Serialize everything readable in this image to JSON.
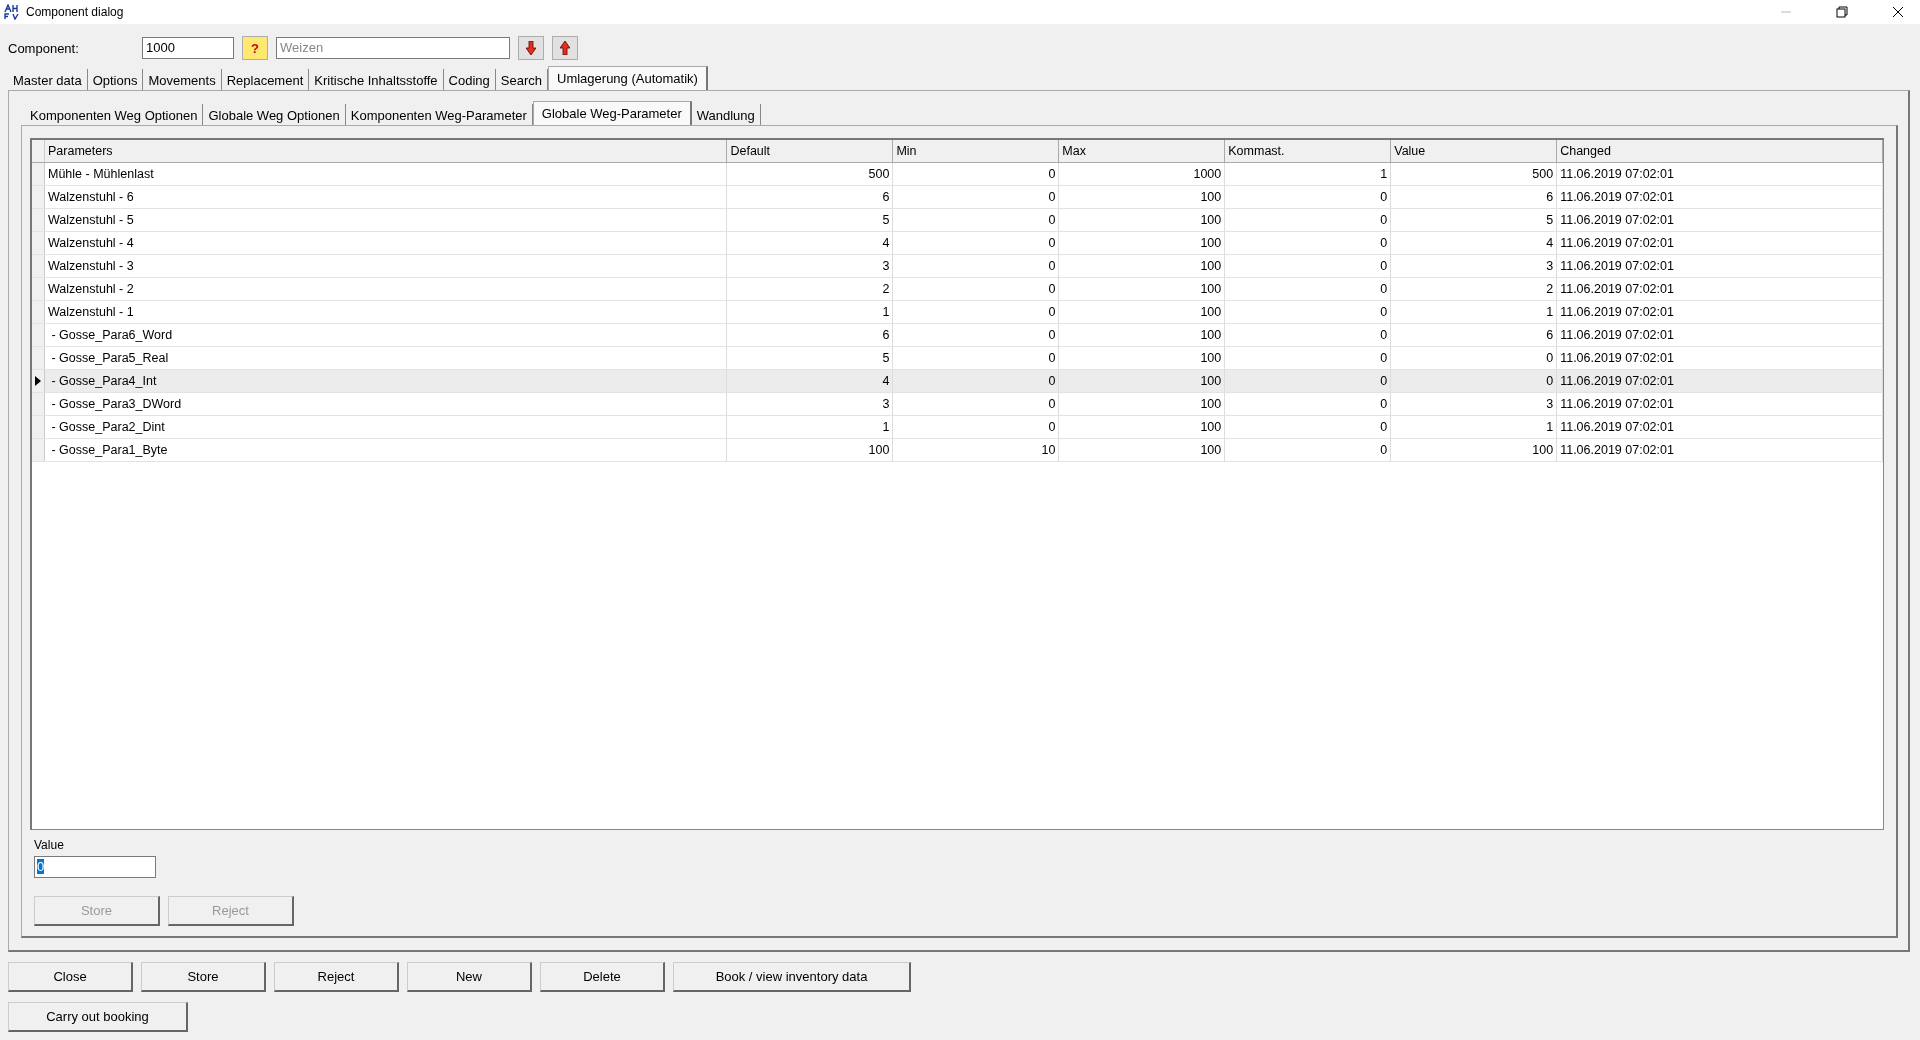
{
  "window": {
    "title": "Component dialog"
  },
  "component": {
    "label": "Component:",
    "number": "1000",
    "help": "?",
    "name": {
      "value": "Weizen",
      "disabled": true
    }
  },
  "tabs": [
    {
      "label": "Master data",
      "selected": false
    },
    {
      "label": "Options",
      "selected": false
    },
    {
      "label": "Movements",
      "selected": false
    },
    {
      "label": "Replacement",
      "selected": false
    },
    {
      "label": "Kritische Inhaltsstoffe",
      "selected": false
    },
    {
      "label": "Coding",
      "selected": false
    },
    {
      "label": "Search",
      "selected": false
    },
    {
      "label": "Umlagerung (Automatik)",
      "selected": true
    }
  ],
  "subtabs": [
    {
      "label": "Komponenten Weg Optionen",
      "selected": false
    },
    {
      "label": "Globale Weg Optionen",
      "selected": false
    },
    {
      "label": "Komponenten Weg-Parameter",
      "selected": false
    },
    {
      "label": "Globale Weg-Parameter",
      "selected": true
    },
    {
      "label": "Wandlung",
      "selected": false
    }
  ],
  "table": {
    "columns": [
      "Parameters",
      "Default",
      "Min",
      "Max",
      "Kommast.",
      "Value",
      "Changed"
    ],
    "rows": [
      {
        "selected": false,
        "cells": [
          "Mühle - Mühlenlast",
          "500",
          "0",
          "1000",
          "1",
          "500",
          "11.06.2019 07:02:01"
        ]
      },
      {
        "selected": false,
        "cells": [
          "Walzenstuhl - 6",
          "6",
          "0",
          "100",
          "0",
          "6",
          "11.06.2019 07:02:01"
        ]
      },
      {
        "selected": false,
        "cells": [
          "Walzenstuhl - 5",
          "5",
          "0",
          "100",
          "0",
          "5",
          "11.06.2019 07:02:01"
        ]
      },
      {
        "selected": false,
        "cells": [
          "Walzenstuhl - 4",
          "4",
          "0",
          "100",
          "0",
          "4",
          "11.06.2019 07:02:01"
        ]
      },
      {
        "selected": false,
        "cells": [
          "Walzenstuhl - 3",
          "3",
          "0",
          "100",
          "0",
          "3",
          "11.06.2019 07:02:01"
        ]
      },
      {
        "selected": false,
        "cells": [
          "Walzenstuhl - 2",
          "2",
          "0",
          "100",
          "0",
          "2",
          "11.06.2019 07:02:01"
        ]
      },
      {
        "selected": false,
        "cells": [
          "Walzenstuhl - 1",
          "1",
          "0",
          "100",
          "0",
          "1",
          "11.06.2019 07:02:01"
        ]
      },
      {
        "selected": false,
        "cells": [
          " - Gosse_Para6_Word",
          "6",
          "0",
          "100",
          "0",
          "6",
          "11.06.2019 07:02:01"
        ]
      },
      {
        "selected": false,
        "cells": [
          " - Gosse_Para5_Real",
          "5",
          "0",
          "100",
          "0",
          "0",
          "11.06.2019 07:02:01"
        ]
      },
      {
        "selected": true,
        "cells": [
          " - Gosse_Para4_Int",
          "4",
          "0",
          "100",
          "0",
          "0",
          "11.06.2019 07:02:01"
        ]
      },
      {
        "selected": false,
        "cells": [
          " - Gosse_Para3_DWord",
          "3",
          "0",
          "100",
          "0",
          "3",
          "11.06.2019 07:02:01"
        ]
      },
      {
        "selected": false,
        "cells": [
          " - Gosse_Para2_Dint",
          "1",
          "0",
          "100",
          "0",
          "1",
          "11.06.2019 07:02:01"
        ]
      },
      {
        "selected": false,
        "cells": [
          " - Gosse_Para1_Byte",
          "100",
          "10",
          "100",
          "0",
          "100",
          "11.06.2019 07:02:01"
        ]
      }
    ]
  },
  "editor": {
    "label": "Value",
    "value": "0",
    "buttons": [
      {
        "label": "Store",
        "disabled": true
      },
      {
        "label": "Reject",
        "disabled": true
      }
    ]
  },
  "buttons": [
    {
      "label": "Close"
    },
    {
      "label": "Store"
    },
    {
      "label": "Reject"
    },
    {
      "label": "New"
    },
    {
      "label": "Delete"
    },
    {
      "label": "Book / view inventory data",
      "wide": true
    }
  ],
  "extra_button": "Carry out booking"
}
